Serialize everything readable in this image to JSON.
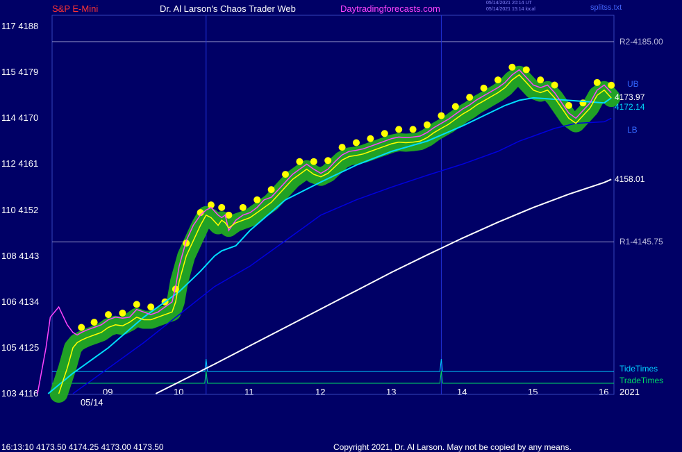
{
  "header": {
    "instrument": "S&P E-Mini",
    "site_title": "Dr. Al Larson's Chaos Trader Web",
    "site_link": "Daytradingforecasts.com",
    "timestamp_ut": "05/14/2021 20:14 UT",
    "timestamp_local": "05/14/2021 15:14 local",
    "file": "splitss.txt"
  },
  "footer": {
    "quote": "16:13:10  4173.50 4174.25 4173.00 4173.50",
    "copyright": "Copyright 2021, Dr. Al Larson. May not be copied by any means."
  },
  "colors": {
    "background": "#000066",
    "price_line": "#ffff00",
    "short_average": "#ff44ff",
    "highlight_dots": "#ffff00",
    "highlight_band": "#22aa22",
    "average_1": "#00ddff",
    "average_2": "#0000dd",
    "white_line": "#ffffff",
    "tide_times": "#00ccff",
    "trade_times": "#00dd66",
    "level_lines": "#9999cc"
  },
  "chart_data": {
    "type": "line",
    "title": "S&P E-Mini",
    "xlabel": "",
    "ylabel": "",
    "x_ticks": [
      "09",
      "10",
      "11",
      "12",
      "13",
      "14",
      "15",
      "16"
    ],
    "x_date_label": "05/14",
    "x_year_label": "2021",
    "ylim": [
      4116,
      4194
    ],
    "y_ticks": [
      {
        "value": 4116,
        "label": "103 4116"
      },
      {
        "value": 4125,
        "label": "105 4125"
      },
      {
        "value": 4134,
        "label": "106 4134"
      },
      {
        "value": 4143,
        "label": "108 4143"
      },
      {
        "value": 4152,
        "label": "110 4152"
      },
      {
        "value": 4161,
        "label": "112 4161"
      },
      {
        "value": 4170,
        "label": "114 4170"
      },
      {
        "value": 4179,
        "label": "115 4179"
      },
      {
        "value": 4188,
        "label": "117 4188"
      }
    ],
    "levels": [
      {
        "name": "R2-4185.00",
        "value": 4185.0
      },
      {
        "name": "R1-4145.75",
        "value": 4145.75
      }
    ],
    "band_labels": {
      "upper": "UB",
      "lower": "LB"
    },
    "last_values": {
      "price": "4173.97",
      "average": "4172.14",
      "white": "4158.01"
    },
    "timing_lines": [
      {
        "name": "TideTimes",
        "spikes_at_hour": [
          10.38,
          13.7
        ]
      },
      {
        "name": "TradeTimes",
        "spikes_at_hour": [
          10.38,
          13.7
        ]
      }
    ],
    "vertical_markers_at_hour": [
      10.38,
      13.7
    ],
    "series": [
      {
        "id": "price",
        "x": [
          8.3,
          8.42,
          8.5,
          8.56,
          8.62,
          8.7,
          8.8,
          8.9,
          9.0,
          9.1,
          9.2,
          9.3,
          9.4,
          9.5,
          9.6,
          9.7,
          9.8,
          9.9,
          9.95,
          10.0,
          10.1,
          10.2,
          10.3,
          10.38,
          10.45,
          10.55,
          10.6,
          10.65,
          10.7,
          10.8,
          10.9,
          11.0,
          11.1,
          11.2,
          11.3,
          11.4,
          11.5,
          11.6,
          11.7,
          11.8,
          11.9,
          12.0,
          12.1,
          12.2,
          12.3,
          12.4,
          12.5,
          12.6,
          12.7,
          12.8,
          12.9,
          13.0,
          13.1,
          13.2,
          13.3,
          13.4,
          13.5,
          13.6,
          13.7,
          13.8,
          13.9,
          14.0,
          14.1,
          14.2,
          14.3,
          14.4,
          14.5,
          14.6,
          14.7,
          14.8,
          14.9,
          15.0,
          15.1,
          15.2,
          15.3,
          15.4,
          15.5,
          15.6,
          15.7,
          15.8,
          15.9,
          16.0,
          16.1
        ],
        "values": [
          4116,
          4121,
          4125,
          4126,
          4126.5,
          4127,
          4127.5,
          4128,
          4129,
          4129.5,
          4129.3,
          4130,
          4131,
          4130.5,
          4130.5,
          4131,
          4131.5,
          4132,
          4134,
          4138,
          4143,
          4146,
          4149,
          4151,
          4150.5,
          4149,
          4150,
          4149.5,
          4148.5,
          4149.5,
          4150,
          4150.5,
          4151.5,
          4152.5,
          4153.5,
          4155,
          4156.5,
          4158,
          4159,
          4160,
          4159,
          4158.5,
          4159.2,
          4160.5,
          4161.8,
          4162.5,
          4162.7,
          4163,
          4163.5,
          4164,
          4164.5,
          4165,
          4165.3,
          4165.2,
          4165.3,
          4165.5,
          4166.2,
          4167.2,
          4168,
          4168.8,
          4169.8,
          4170.8,
          4171.6,
          4172.6,
          4173.4,
          4174.2,
          4175,
          4176,
          4177.5,
          4178.5,
          4177,
          4175.5,
          4175,
          4175.5,
          4174,
          4172,
          4170,
          4169,
          4170.5,
          4172,
          4174.5,
          4175.5,
          4173.97
        ]
      },
      {
        "id": "short_average",
        "x": [
          8.0,
          8.12,
          8.18,
          8.3,
          8.42,
          8.5,
          8.56,
          8.62,
          8.7,
          8.8,
          8.9,
          9.0,
          9.1,
          9.2,
          9.3,
          9.4,
          9.5,
          9.6,
          9.7,
          9.8,
          9.9,
          9.95,
          10.0,
          10.1,
          10.2,
          10.3,
          10.38,
          10.45,
          10.55,
          10.6,
          10.65,
          10.7,
          10.8,
          10.9,
          11.0,
          11.1,
          11.2,
          11.3,
          11.4,
          11.5,
          11.6,
          11.7,
          11.8,
          11.9,
          12.0,
          12.1,
          12.2,
          12.3,
          12.4,
          12.5,
          12.6,
          12.7,
          12.8,
          12.9,
          13.0,
          13.1,
          13.2,
          13.3,
          13.4,
          13.5,
          13.6,
          13.7,
          13.8,
          13.9,
          14.0,
          14.1,
          14.2,
          14.3,
          14.4,
          14.5,
          14.6,
          14.7,
          14.8,
          14.9,
          15.0,
          15.1,
          15.2,
          15.3,
          15.4,
          15.5,
          15.6,
          15.7,
          15.8,
          15.9,
          16.0,
          16.1
        ],
        "values": [
          4116,
          4125,
          4131,
          4133,
          4129.5,
          4128,
          4127.5,
          4128,
          4128.5,
          4129,
          4129.5,
          4130.5,
          4131,
          4130.8,
          4131,
          4132.5,
          4132,
          4131.5,
          4132,
          4133,
          4134,
          4137,
          4141,
          4146,
          4149,
          4151,
          4152,
          4152.5,
          4151,
          4150.5,
          4151,
          4148,
          4150,
          4151,
          4151.5,
          4152.5,
          4154,
          4154.5,
          4156,
          4157.5,
          4159,
          4160,
          4161,
          4160,
          4159.2,
          4160,
          4161.5,
          4162.8,
          4163.5,
          4163.7,
          4164,
          4164.5,
          4165,
          4165.5,
          4166,
          4166.3,
          4166.2,
          4166.3,
          4166.5,
          4167.2,
          4168.2,
          4169,
          4169.8,
          4170.8,
          4171.8,
          4172.6,
          4173.6,
          4174.4,
          4175.2,
          4176,
          4177,
          4178.5,
          4179.5,
          4178,
          4176.5,
          4176,
          4176.5,
          4175,
          4173,
          4171,
          4170,
          4171.5,
          4173,
          4175.5,
          4176.5,
          4175
        ]
      },
      {
        "id": "average_1",
        "x": [
          8.15,
          8.5,
          9.0,
          9.5,
          10.0,
          10.3,
          10.5,
          10.6,
          10.8,
          11.0,
          11.5,
          12.0,
          12.5,
          13.0,
          13.5,
          14.0,
          14.3,
          14.6,
          14.8,
          15.0,
          15.5,
          16.0,
          16.1
        ],
        "values": [
          4116,
          4120,
          4125,
          4131,
          4136,
          4140,
          4143,
          4144,
          4145,
          4148,
          4154,
          4157.5,
          4160.8,
          4163.5,
          4165.5,
          4168.5,
          4170.5,
          4172.5,
          4173.5,
          4174,
          4173.5,
          4173,
          4174
        ]
      },
      {
        "id": "average_2",
        "x": [
          8.5,
          9.0,
          9.5,
          10.0,
          10.5,
          11.0,
          11.5,
          12.0,
          12.5,
          13.0,
          13.5,
          14.0,
          14.5,
          14.8,
          15.0,
          15.3,
          15.6,
          16.0,
          16.1
        ],
        "values": [
          4116,
          4121,
          4126,
          4131.5,
          4137,
          4141,
          4146,
          4151,
          4154,
          4156.5,
          4158.8,
          4161,
          4163.5,
          4165.5,
          4166.5,
          4168,
          4169,
          4169.3,
          4170
        ]
      },
      {
        "id": "white",
        "x": [
          9.67,
          10.0,
          10.5,
          11.0,
          11.5,
          12.0,
          12.5,
          13.0,
          13.5,
          14.0,
          14.5,
          15.0,
          15.5,
          16.0,
          16.1
        ],
        "values": [
          4116,
          4118.3,
          4121.8,
          4125.4,
          4129,
          4132.6,
          4136.2,
          4139.8,
          4143.2,
          4146.5,
          4149.6,
          4152.5,
          4155.1,
          4157.4,
          4158.01
        ]
      }
    ]
  }
}
